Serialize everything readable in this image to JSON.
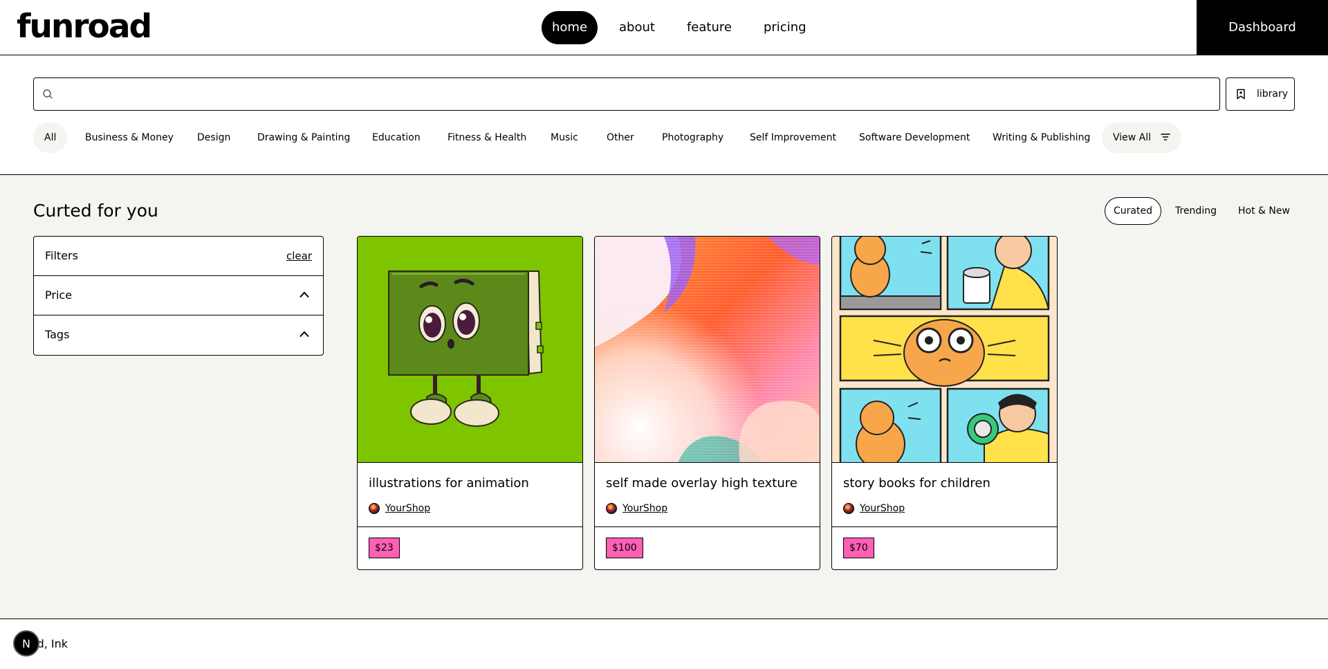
{
  "header": {
    "logo": "funroad",
    "nav": [
      {
        "label": "home",
        "active": true
      },
      {
        "label": "about",
        "active": false
      },
      {
        "label": "feature",
        "active": false
      },
      {
        "label": "pricing",
        "active": false
      }
    ],
    "dashboard_label": "Dashboard"
  },
  "search": {
    "placeholder": "",
    "value": "",
    "icon": "search-icon",
    "library_label": "library",
    "library_icon": "bookmark-icon"
  },
  "categories": {
    "items": [
      "All",
      "Business & Money",
      "Design",
      "Drawing & Painting",
      "Education",
      "Fitness & Health",
      "Music",
      "Other",
      "Photography",
      "Self Improvement",
      "Software Development",
      "Writing & Publishing"
    ],
    "selected": "All",
    "view_all_label": "View All",
    "view_all_icon": "filter-lines-icon"
  },
  "main": {
    "title": "Curted for you",
    "sort_tabs": [
      "Curated",
      "Trending",
      "Hot & New"
    ],
    "sort_selected": "Curated"
  },
  "filters": {
    "title": "Filters",
    "clear_label": "clear",
    "sections": [
      "Price",
      "Tags"
    ]
  },
  "products": [
    {
      "title": "illustrations for animation",
      "author": "YourShop",
      "price": "$23",
      "image": "green-book-character-illustration"
    },
    {
      "title": "self made overlay high texture",
      "author": "YourShop",
      "price": "$100",
      "image": "colorful-gradient-texture"
    },
    {
      "title": "story books for children",
      "author": "YourShop",
      "price": "$70",
      "image": "cat-comic-panels"
    }
  ],
  "footer": {
    "text": "oad, Ink",
    "badge": "N"
  },
  "colors": {
    "price_tag": "#ff5fb4",
    "background": "#f4f4f0",
    "green_card": "#7ec500"
  }
}
